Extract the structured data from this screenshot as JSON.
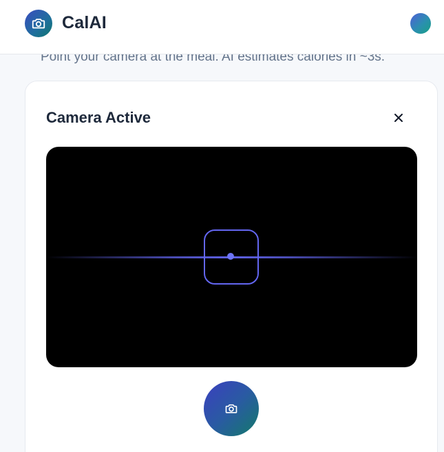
{
  "header": {
    "app_title": "CalAI",
    "logo_icon": "camera-icon",
    "avatar_icon": "user-avatar"
  },
  "subtitle": "Point your camera at the meal. AI estimates calories in ~3s.",
  "camera_card": {
    "title": "Camera Active",
    "close_icon": "close-icon",
    "viewfinder_icon": "focus-frame-icon",
    "capture_icon": "camera-icon"
  },
  "colors": {
    "accent": "#6366f1",
    "brand_gradient_start": "#3b3fbf",
    "brand_gradient_end": "#137a6a",
    "viewport_bg": "#000000"
  }
}
